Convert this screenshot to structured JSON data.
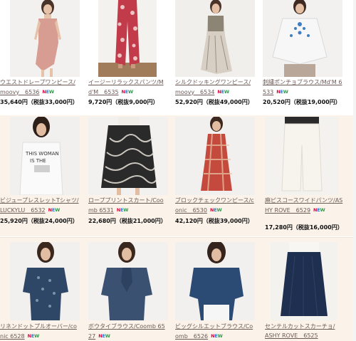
{
  "colors": {
    "new_n": "#e3003f",
    "new_e": "#2a7ad1",
    "new_w": "#2a9a47",
    "link": "#6b5a55"
  },
  "new_badge": {
    "n": "N",
    "e": "E",
    "w": "W"
  },
  "products": [
    {
      "name": "ウエストドレープワンピース/moovy　6536",
      "price": "35,640円（税抜33,000円）",
      "new": true
    },
    {
      "name": "イージーリラックスパンツ/Md'M　6535",
      "price": "9,720円（税抜9,000円）",
      "new": true
    },
    {
      "name": "シルクドッキングワンピース/moovy　6534",
      "price": "52,920円（税抜49,000円）",
      "new": true
    },
    {
      "name": "刺繍ポンチョブラウス/Md'M 6533",
      "price": "20,520円（税抜19,000円）",
      "new": true
    },
    {
      "name": "ビジュープレスレットTシャツ/LUCKYLU　6532",
      "price": "25,920円（税抜24,000円）",
      "new": true
    },
    {
      "name": "ローププリントスカート/Coomb 6531",
      "price": "22,680円（税抜21,000円）",
      "new": true
    },
    {
      "name": "ブロックチェックワンピース/conic　6530",
      "price": "42,120円（税抜39,000円）",
      "new": true
    },
    {
      "name": "麻ピスコースワイドパンツ/ASHY ROVE　6529",
      "price": "17,280円（税抜16,000円）",
      "new": true
    },
    {
      "name": "リネンドットプルオーバー/conic 6528",
      "price": "",
      "new": true
    },
    {
      "name": "ボウタイブラウス/Coomb 6527",
      "price": "",
      "new": true
    },
    {
      "name": "ビッグシルエットブラウス/Coomb　6526",
      "price": "",
      "new": true
    },
    {
      "name": "センテルカットスカーチョ/ASHY ROVE　6525",
      "price": "",
      "new": false
    }
  ]
}
